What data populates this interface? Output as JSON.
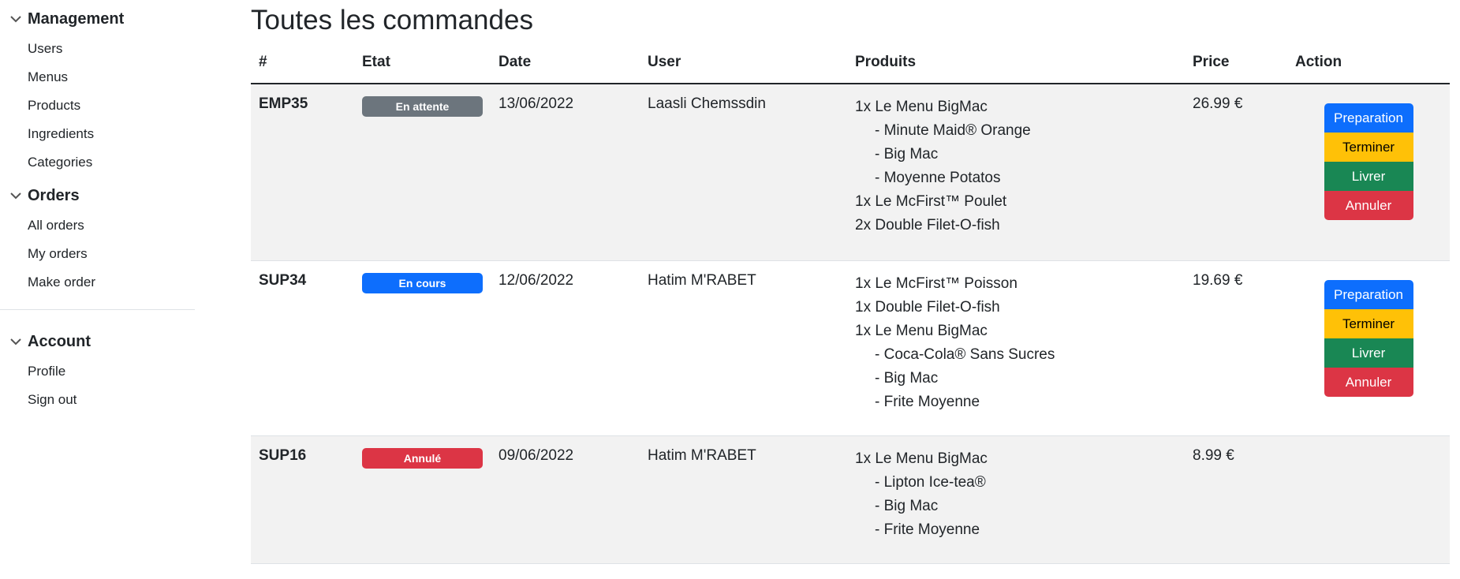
{
  "sidebar": {
    "sections": [
      {
        "title": "Management",
        "items": [
          "Users",
          "Menus",
          "Products",
          "Ingredients",
          "Categories"
        ]
      },
      {
        "title": "Orders",
        "items": [
          "All orders",
          "My orders",
          "Make order"
        ]
      },
      {
        "title": "Account",
        "items": [
          "Profile",
          "Sign out"
        ]
      }
    ]
  },
  "main": {
    "title": "Toutes les commandes",
    "columns": [
      "#",
      "Etat",
      "Date",
      "User",
      "Produits",
      "Price",
      "Action"
    ],
    "orders": [
      {
        "id": "EMP35",
        "status": "En attente",
        "status_color": "#6c757d",
        "date": "13/06/2022",
        "user": "Laasli Chemssdin",
        "products": [
          {
            "text": "1x Le Menu BigMac",
            "sub": false
          },
          {
            "text": "- Minute Maid® Orange",
            "sub": true
          },
          {
            "text": "- Big Mac",
            "sub": true
          },
          {
            "text": "- Moyenne Potatos",
            "sub": true
          },
          {
            "text": "1x Le McFirst™ Poulet",
            "sub": false
          },
          {
            "text": "2x Double Filet-O-fish",
            "sub": false
          }
        ],
        "price": "26.99 €",
        "actions": [
          "Preparation",
          "Terminer",
          "Livrer",
          "Annuler"
        ]
      },
      {
        "id": "SUP34",
        "status": "En cours",
        "status_color": "#0d6efd",
        "date": "12/06/2022",
        "user": "Hatim M'RABET",
        "products": [
          {
            "text": "1x Le McFirst™ Poisson",
            "sub": false
          },
          {
            "text": "1x Double Filet-O-fish",
            "sub": false
          },
          {
            "text": "1x Le Menu BigMac",
            "sub": false
          },
          {
            "text": "- Coca-Cola® Sans Sucres",
            "sub": true
          },
          {
            "text": "- Big Mac",
            "sub": true
          },
          {
            "text": "- Frite Moyenne",
            "sub": true
          }
        ],
        "price": "19.69 €",
        "actions": [
          "Preparation",
          "Terminer",
          "Livrer",
          "Annuler"
        ]
      },
      {
        "id": "SUP16",
        "status": "Annulé",
        "status_color": "#dc3545",
        "date": "09/06/2022",
        "user": "Hatim M'RABET",
        "products": [
          {
            "text": "1x Le Menu BigMac",
            "sub": false
          },
          {
            "text": "- Lipton Ice-tea®",
            "sub": true
          },
          {
            "text": "- Big Mac",
            "sub": true
          },
          {
            "text": "- Frite Moyenne",
            "sub": true
          }
        ],
        "price": "8.99 €",
        "actions": []
      }
    ]
  },
  "colors": {
    "preparation": "#0d6efd",
    "terminer": "#ffc107",
    "livrer": "#198754",
    "annuler": "#dc3545"
  }
}
